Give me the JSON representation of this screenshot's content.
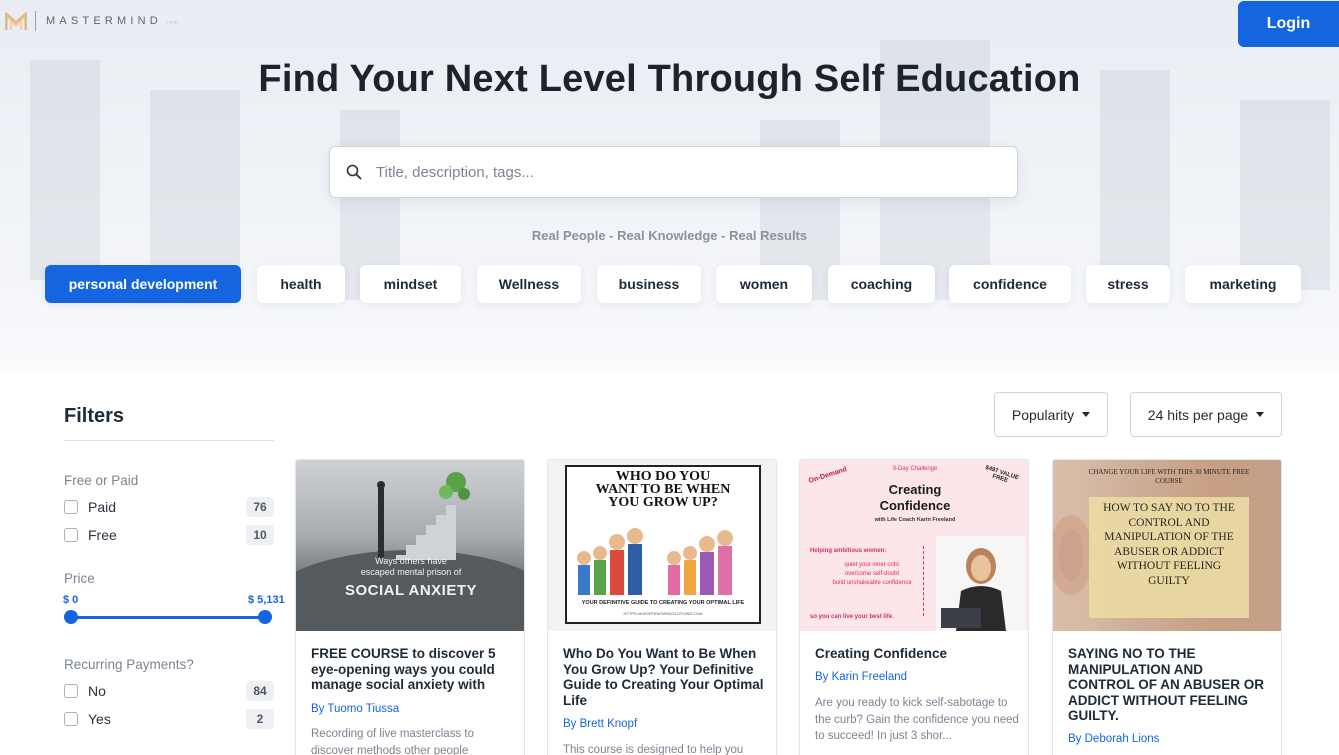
{
  "brand": {
    "name": "MASTERMIND",
    "domain": ".com"
  },
  "header": {
    "login_label": "Login"
  },
  "hero": {
    "title": "Find Your Next Level Through Self Education",
    "search_placeholder": "Title, description, tags...",
    "tagline": "Real People - Real Knowledge - Real Results"
  },
  "tags": [
    {
      "label": "personal development",
      "active": true
    },
    {
      "label": "health"
    },
    {
      "label": "mindset"
    },
    {
      "label": "Wellness"
    },
    {
      "label": "business"
    },
    {
      "label": "women"
    },
    {
      "label": "coaching"
    },
    {
      "label": "confidence"
    },
    {
      "label": "stress"
    },
    {
      "label": "marketing"
    }
  ],
  "filters": {
    "title": "Filters",
    "free_or_paid": {
      "heading": "Free or Paid",
      "options": [
        {
          "label": "Paid",
          "count": "76"
        },
        {
          "label": "Free",
          "count": "10"
        }
      ]
    },
    "price": {
      "heading": "Price",
      "min_label": "$ 0",
      "max_label": "$ 5,131"
    },
    "recurring": {
      "heading": "Recurring Payments?",
      "options": [
        {
          "label": "No",
          "count": "84"
        },
        {
          "label": "Yes",
          "count": "2"
        }
      ]
    }
  },
  "sort": {
    "order_label": "Popularity",
    "per_page_label": "24 hits per page"
  },
  "cards": [
    {
      "title": "FREE COURSE to discover 5 eye-opening ways you could manage social anxiety with",
      "author": "By Tuomo Tiussa",
      "description": "Recording of live masterclass to discover methods other people",
      "image_text": {
        "line1": "Ways others have",
        "line2": "escaped mental prison of",
        "line3": "SOCIAL ANXIETY"
      }
    },
    {
      "title": "Who Do You Want to Be When You Grow Up? Your Definitive Guide to Creating Your Optimal Life",
      "author": "By Brett Knopf",
      "description": "This course is designed to help you",
      "image_text": {
        "headline": "WHO DO YOU WANT TO BE WHEN YOU GROW UP?",
        "footer": "YOUR DEFINITIVE GUIDE TO CREATING YOUR OPTIMAL LIFE",
        "url": "HTTPS://KNOPFKNOWSSOLUTIONS.COM"
      }
    },
    {
      "title": "Creating Confidence",
      "author": "By Karin Freeland",
      "description": "Are you ready to kick self-sabotage to the curb? Gain the confidence you need to succeed! In just 3 shor...",
      "image_text": {
        "badge_left": "On-Demand",
        "challenge": "3-Day Challenge",
        "badge_right": "$497 VALUE FREE",
        "title": "Creating Confidence",
        "subtitle": "with Life Coach Karin Freeland",
        "helping": "Helping ambitious women:",
        "bullets": [
          "quiet your inner critic",
          "overcome self-doubt",
          "build unshakeable confidence"
        ],
        "closing": "so you can live your best life."
      }
    },
    {
      "title": "SAYING NO TO THE MANIPULATION AND CONTROL OF AN ABUSER OR ADDICT WITHOUT FEELING GUILTY.",
      "author": "By Deborah Lions",
      "description": "",
      "image_text": {
        "top": "CHANGE YOUR LIFE WITH THIS 30 MINUTE FREE COURSE",
        "main": "HOW TO SAY NO TO THE CONTROL AND MANIPULATION OF THE ABUSER OR ADDICT WITHOUT FEELING GUILTY"
      }
    }
  ],
  "colors": {
    "accent": "#1565e0"
  }
}
